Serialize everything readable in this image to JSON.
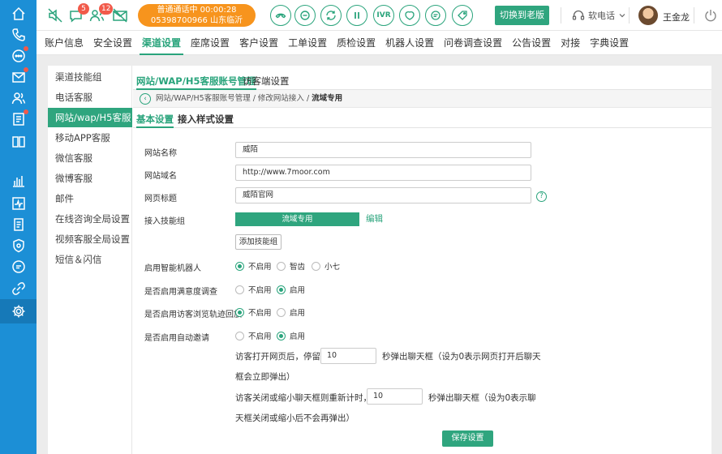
{
  "topbar": {
    "badges": {
      "chat": "5",
      "users": "12"
    },
    "call": {
      "status_line": "普通通话中  00:00:28",
      "number_line": "05398700966 山东临沂"
    },
    "ivr_label": "IVR",
    "switch_label": "切换到老版",
    "softphone_label": "软电话",
    "username": "王金龙"
  },
  "mainmenu": {
    "items": [
      "账户信息",
      "安全设置",
      "渠道设置",
      "座席设置",
      "客户设置",
      "工单设置",
      "质检设置",
      "机器人设置",
      "问卷调查设置",
      "公告设置",
      "对接",
      "字典设置"
    ],
    "active_index": 2
  },
  "subnav": {
    "items": [
      "渠道技能组",
      "电话客服",
      "网站/wap/H5客服",
      "移动APP客服",
      "微信客服",
      "微博客服",
      "邮件",
      "在线咨询全局设置",
      "视频客服全局设置",
      "短信＆闪信"
    ],
    "active_index": 2
  },
  "tabs": {
    "primary": [
      "网站/WAP/H5客服账号管理",
      "访客端设置"
    ],
    "secondary": [
      "基本设置",
      "接入样式设置"
    ]
  },
  "breadcrumb": {
    "path": "网站/WAP/H5客服账号管理 / 修改网站接入 / ",
    "current": "流域专用"
  },
  "form": {
    "site_name": {
      "label": "网站名称",
      "value": "威陌"
    },
    "site_domain": {
      "label": "网站域名",
      "value": "http://www.7moor.com"
    },
    "page_title": {
      "label": "网页标题",
      "value": "威陌官网",
      "help": "?"
    },
    "skill_group": {
      "label": "接入技能组",
      "tag": "流域专用",
      "edit": "编辑",
      "add": "添加技能组"
    },
    "robot": {
      "label": "启用智能机器人",
      "options": [
        "不启用",
        "智齿",
        "小七"
      ],
      "selected": 0
    },
    "satisfaction": {
      "label": "是否启用满意度调查",
      "options": [
        "不启用",
        "启用"
      ],
      "selected": 1
    },
    "track": {
      "label": "是否启用访客浏览轨迹回放",
      "options": [
        "不启用",
        "启用"
      ],
      "selected": 0
    },
    "auto_invite": {
      "label": "是否启用自动邀请",
      "options": [
        "不启用",
        "启用"
      ],
      "selected": 1
    },
    "invite_open": {
      "prefix": "访客打开网页后，停留",
      "value": "10",
      "suffix_1": "秒弹出聊天框（设为0表示网页打开后聊天",
      "suffix_2": "框会立即弹出）"
    },
    "invite_reopen": {
      "prefix": "访客关闭或缩小聊天框则重新计时，",
      "value": "10",
      "suffix_1": "秒弹出聊天框（设为0表示聊",
      "suffix_2": "天框关闭或缩小后不会再弹出）"
    },
    "save_label": "保存设置"
  },
  "colors": {
    "nav_blue": "#1c8fd6",
    "accent_green": "#2aa47c",
    "call_orange": "#f7941d",
    "badge_red": "#f15a4a"
  }
}
